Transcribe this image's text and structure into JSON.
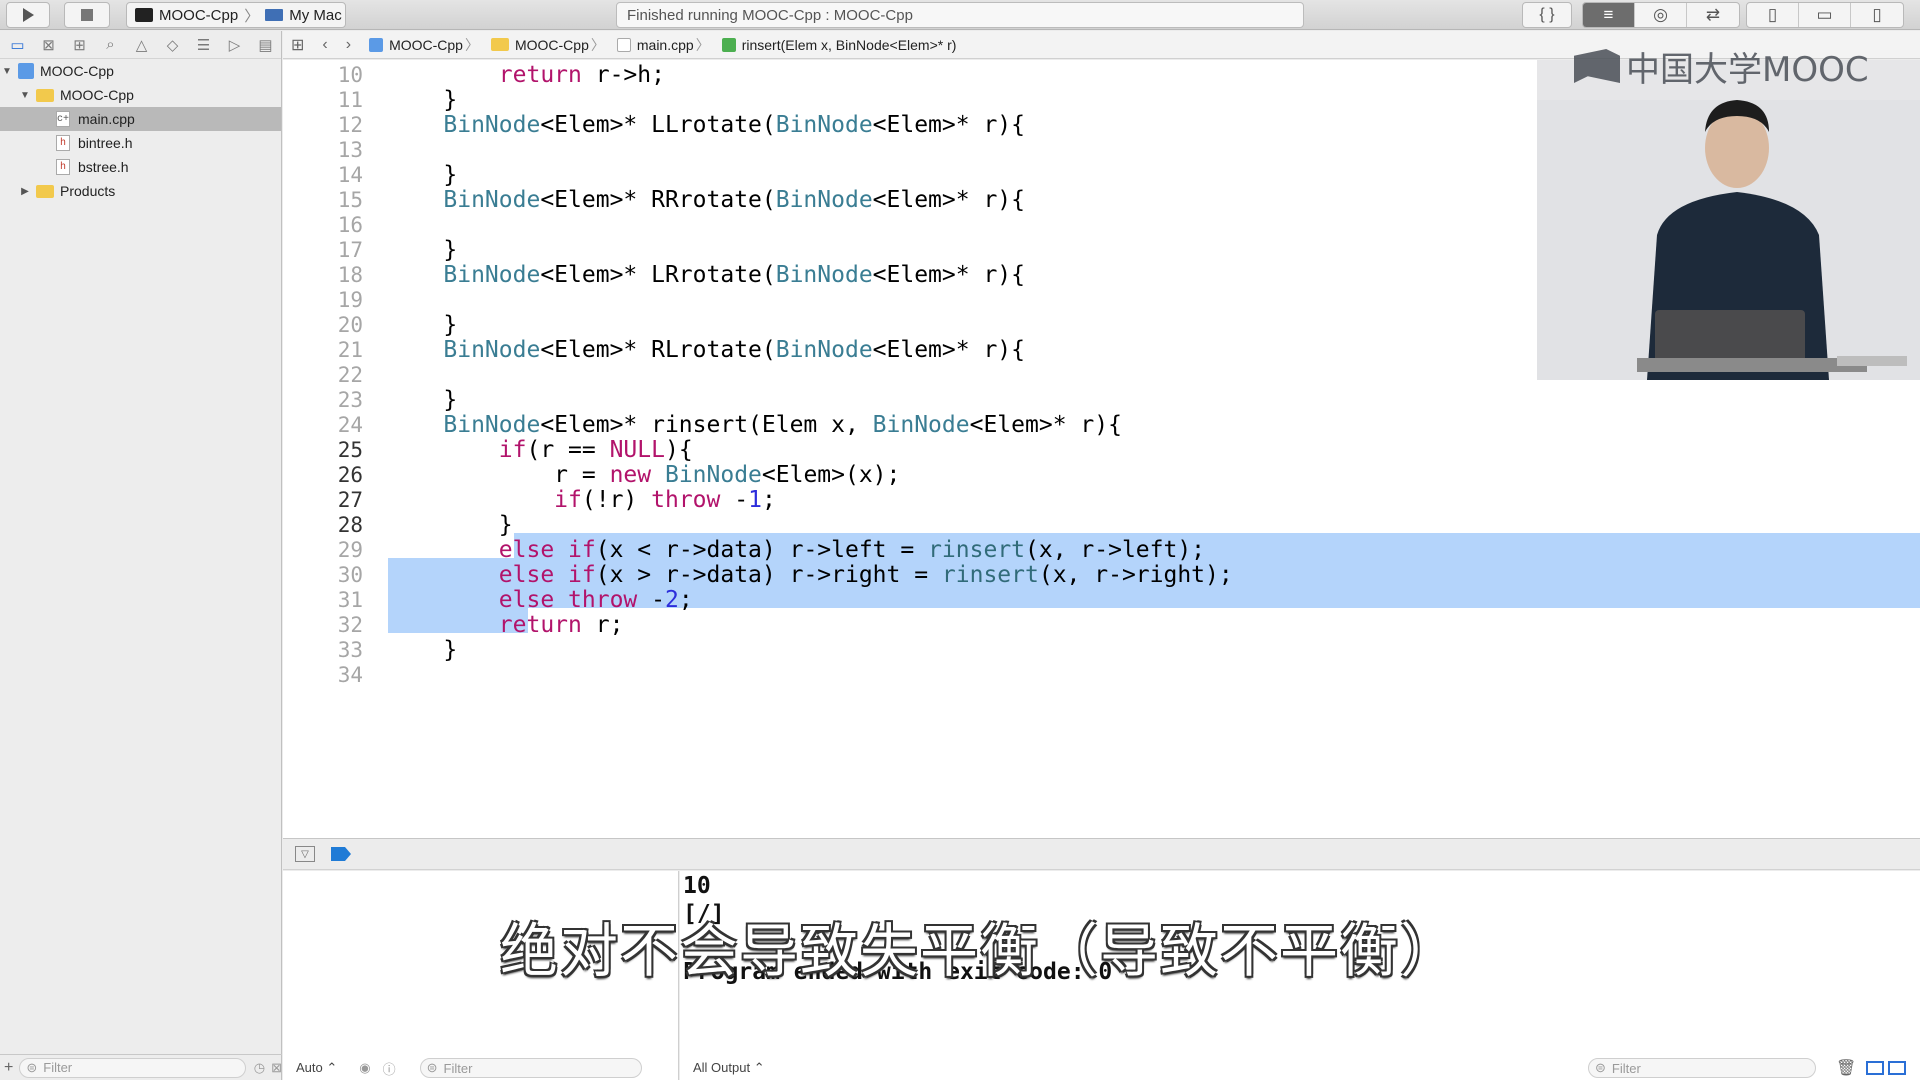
{
  "toolbar": {
    "scheme_project": "MOOC-Cpp",
    "scheme_device": "My Mac",
    "status_text": "Finished running MOOC-Cpp : MOOC-Cpp"
  },
  "navigator": {
    "items": [
      {
        "label": "MOOC-Cpp",
        "kind": "project"
      },
      {
        "label": "MOOC-Cpp",
        "kind": "folder"
      },
      {
        "label": "main.cpp",
        "kind": "file",
        "selected": true
      },
      {
        "label": "bintree.h",
        "kind": "header"
      },
      {
        "label": "bstree.h",
        "kind": "header"
      },
      {
        "label": "Products",
        "kind": "folder"
      }
    ],
    "filter_placeholder": "Filter"
  },
  "jumpbar": {
    "crumbs": [
      "MOOC-Cpp",
      "MOOC-Cpp",
      "main.cpp",
      "rinsert(Elem x, BinNode<Elem>* r)"
    ]
  },
  "editor": {
    "lines": [
      {
        "n": "10",
        "code": "        return r->h;"
      },
      {
        "n": "11",
        "code": "    }"
      },
      {
        "n": "12",
        "code": "    BinNode<Elem>* LLrotate(BinNode<Elem>* r){"
      },
      {
        "n": "13",
        "code": ""
      },
      {
        "n": "14",
        "code": "    }"
      },
      {
        "n": "15",
        "code": "    BinNode<Elem>* RRrotate(BinNode<Elem>* r){"
      },
      {
        "n": "16",
        "code": ""
      },
      {
        "n": "17",
        "code": "    }"
      },
      {
        "n": "18",
        "code": "    BinNode<Elem>* LRrotate(BinNode<Elem>* r){"
      },
      {
        "n": "19",
        "code": ""
      },
      {
        "n": "20",
        "code": "    }"
      },
      {
        "n": "21",
        "code": "    BinNode<Elem>* RLrotate(BinNode<Elem>* r){"
      },
      {
        "n": "22",
        "code": ""
      },
      {
        "n": "23",
        "code": "    }"
      },
      {
        "n": "24",
        "code": "    BinNode<Elem>* rinsert(Elem x, BinNode<Elem>* r){"
      },
      {
        "n": "25",
        "code": "        if(r == NULL){",
        "highlight": true
      },
      {
        "n": "26",
        "code": "            r = new BinNode<Elem>(x);",
        "highlight": true
      },
      {
        "n": "27",
        "code": "            if(!r) throw -1;",
        "highlight": true
      },
      {
        "n": "28",
        "code": "        }",
        "highlight": true
      },
      {
        "n": "29",
        "code": "        else if(x < r->data) r->left = rinsert(x, r->left);"
      },
      {
        "n": "30",
        "code": "        else if(x > r->data) r->right = rinsert(x, r->right);"
      },
      {
        "n": "31",
        "code": "        else throw -2;"
      },
      {
        "n": "32",
        "code": "        return r;"
      },
      {
        "n": "33",
        "code": "    }"
      },
      {
        "n": "34",
        "code": ""
      }
    ]
  },
  "console": {
    "lines": [
      "10",
      "[/]",
      "Program ended with exit code: 0"
    ]
  },
  "debug": {
    "auto_label": "Auto ⌃",
    "filter_placeholder": "Filter",
    "output_label": "All Output ⌃"
  },
  "overlay": {
    "logo_text": "中国大学MOOC",
    "subtitle": "绝对不会导致失平衡（导致不平衡）"
  },
  "colors": {
    "keyword": "#b2136b",
    "type": "#3a7d93",
    "number": "#2c2ddb",
    "selection": "#b4d4fb"
  }
}
